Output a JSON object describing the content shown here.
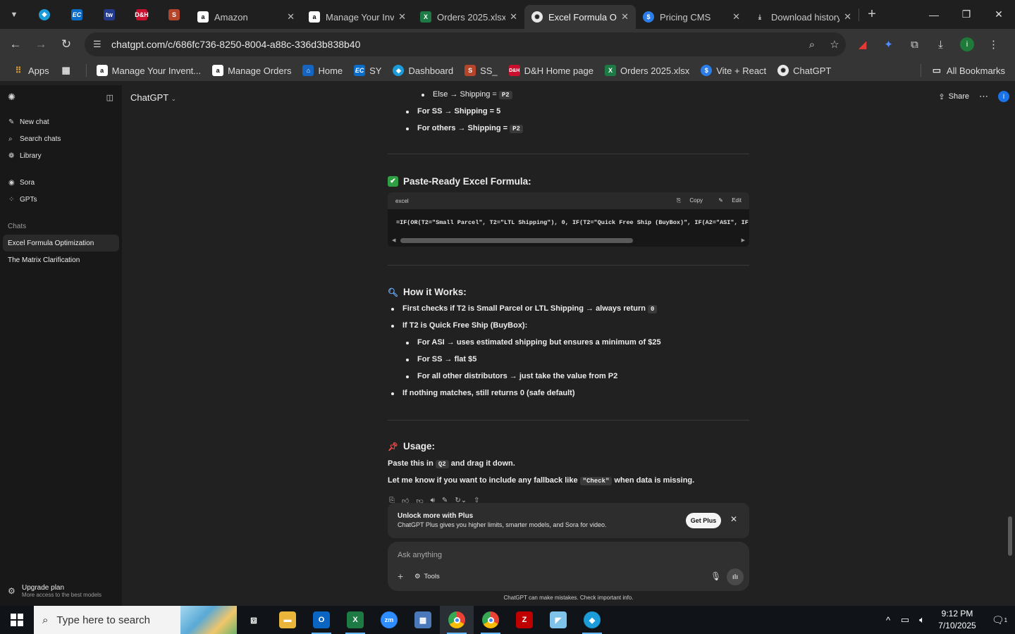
{
  "browser": {
    "tabs": [
      {
        "title": "Amazon",
        "icon": "amazon-icon"
      },
      {
        "title": "Manage Your Inventory",
        "icon": "amazon-icon"
      },
      {
        "title": "Orders 2025.xlsx",
        "icon": "excel-icon"
      },
      {
        "title": "Excel Formula Optimization",
        "icon": "chatgpt-icon",
        "active": true
      },
      {
        "title": "Pricing CMS",
        "icon": "dollar-icon"
      },
      {
        "title": "Download history",
        "icon": "download-icon"
      }
    ],
    "url": "chatgpt.com/c/686fc736-8250-8004-a88c-336d3b838b40",
    "bookmarks": [
      {
        "label": "Apps"
      },
      {
        "label": "Manage Your Invent..."
      },
      {
        "label": "Manage Orders"
      },
      {
        "label": "Home"
      },
      {
        "label": "SY"
      },
      {
        "label": "Dashboard"
      },
      {
        "label": "SS_"
      },
      {
        "label": "D&H Home page"
      },
      {
        "label": "Orders 2025.xlsx"
      },
      {
        "label": "Vite + React"
      },
      {
        "label": "ChatGPT"
      }
    ],
    "all_bookmarks": "All Bookmarks"
  },
  "sidebar": {
    "items": [
      {
        "label": "New chat"
      },
      {
        "label": "Search chats"
      },
      {
        "label": "Library"
      },
      {
        "label": "Sora"
      },
      {
        "label": "GPTs"
      }
    ],
    "chats_label": "Chats",
    "chats": [
      {
        "label": "Excel Formula Optimization",
        "active": true
      },
      {
        "label": "The Matrix Clarification"
      }
    ],
    "upgrade_title": "Upgrade plan",
    "upgrade_sub": "More access to the best models"
  },
  "header": {
    "model": "ChatGPT",
    "share": "Share",
    "avatar": "I"
  },
  "message": {
    "top_bullets": {
      "else_pre": "Else → Shipping = ",
      "else_code": "P2",
      "ss": "For SS → Shipping = 5",
      "others_pre": "For others → Shipping = ",
      "others_code": "P2"
    },
    "formula_heading": "Paste-Ready Excel Formula:",
    "code_lang": "excel",
    "copy": "Copy",
    "edit": "Edit",
    "formula": "=IF(OR(T2=\"Small Parcel\", T2=\"LTL Shipping\"), 0, IF(T2=\"Quick Free Ship (BuyBox)\", IF(A2=\"ASI\", IF",
    "how_heading": "How it Works:",
    "how": {
      "b1_pre": "First checks if T2 is ",
      "b1_bold": "Small Parcel or LTL Shipping",
      "b1_post": " → always return ",
      "b1_code": "0",
      "b2_pre": "If T2 is ",
      "b2_bold": "Quick Free Ship (BuyBox)",
      "b2_post": ":",
      "s1_pre": "For ",
      "s1_bold": "ASI",
      "s1_mid": " → uses estimated shipping but ensures a ",
      "s1_bold2": "minimum of $25",
      "s2_pre": "For ",
      "s2_bold": "SS",
      "s2_post": " → flat $5",
      "s3": "For all other distributors → just take the value from P2",
      "b3": "If nothing matches, still returns 0 (safe default)"
    },
    "usage_heading": "Usage:",
    "usage_pre": "Paste this in ",
    "usage_code": "Q2",
    "usage_post": " and drag it down.",
    "fallback_pre": "Let me know if you want to include any fallback like ",
    "fallback_code": "\"Check\"",
    "fallback_post": " when data is missing."
  },
  "plus_banner": {
    "title": "Unlock more with Plus",
    "subtitle": "ChatGPT Plus gives you higher limits, smarter models, and Sora for video.",
    "button": "Get Plus"
  },
  "composer": {
    "placeholder": "Ask anything",
    "tools": "Tools"
  },
  "disclaimer": "ChatGPT can make mistakes. Check important info.",
  "taskbar": {
    "search_placeholder": "Type here to search",
    "time": "9:12 PM",
    "date": "7/10/2025",
    "notifications": "1"
  }
}
